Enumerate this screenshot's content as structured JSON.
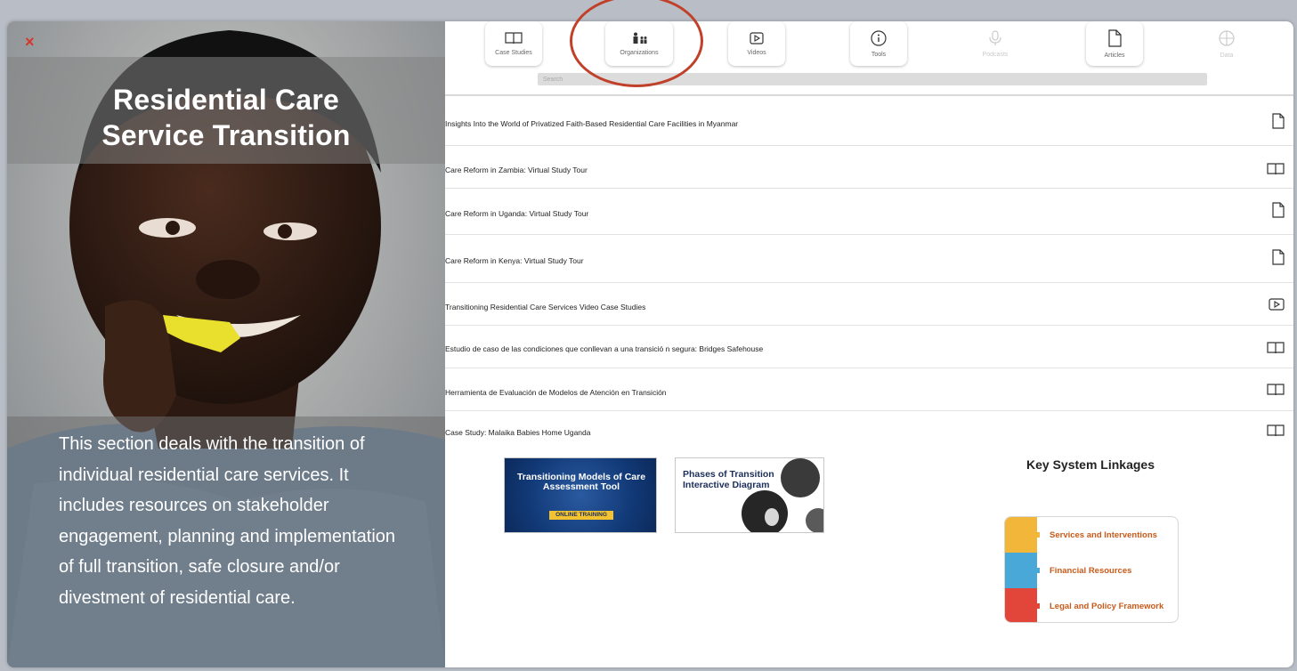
{
  "close_label": "×",
  "left": {
    "title_line1": "Residential Care",
    "title_line2": "Service Transition",
    "description": "This section deals with the transition of individual residential care services. It includes resources on stakeholder engagement, planning and implementation of full transition, safe closure and/or divestment of residential care."
  },
  "toolbar": {
    "items": [
      {
        "label": "Case Studies",
        "icon": "book-icon"
      },
      {
        "label": "Organizations",
        "icon": "organizations-icon"
      },
      {
        "label": "Videos",
        "icon": "play-icon"
      },
      {
        "label": "Tools",
        "icon": "info-icon"
      },
      {
        "label": "Podcasts",
        "icon": "microphone-icon"
      },
      {
        "label": "Articles",
        "icon": "document-icon"
      },
      {
        "label": "Data",
        "icon": "globe-icon"
      }
    ],
    "search_placeholder": "Search"
  },
  "resources": [
    {
      "title": "Insights Into the World of Privatized Faith-Based Residential Care Facilities in Myanmar",
      "icon": "document-icon"
    },
    {
      "title": "Care Reform in Zambia: Virtual Study Tour",
      "icon": "book-icon"
    },
    {
      "title": "Care Reform in Uganda: Virtual Study Tour",
      "icon": "document-icon"
    },
    {
      "title": "Care Reform in Kenya: Virtual Study Tour",
      "icon": "document-icon"
    },
    {
      "title": "Transitioning Residential Care Services Video Case Studies",
      "icon": "play-icon"
    },
    {
      "title": "Estudio de caso de las condiciones que conllevan a una transició n segura: Bridges Safehouse",
      "icon": "book-icon"
    },
    {
      "title": "Herramienta de Evaluación de Modelos de Atención en Transición",
      "icon": "book-icon"
    },
    {
      "title": "Case Study: Malaika Babies Home Uganda",
      "icon": "book-icon"
    }
  ],
  "promos": {
    "tool_title": "Transitioning Models of Care Assessment Tool",
    "tool_badge": "ONLINE TRAINING",
    "diagram_title": "Phases of Transition Interactive Diagram"
  },
  "key_linkages": {
    "title": "Key System Linkages",
    "items": [
      {
        "label": "Services and Interventions",
        "color": "#f2b63a"
      },
      {
        "label": "Financial Resources",
        "color": "#49a8d8"
      },
      {
        "label": "Legal and Policy Framework",
        "color": "#e2463a"
      }
    ]
  }
}
